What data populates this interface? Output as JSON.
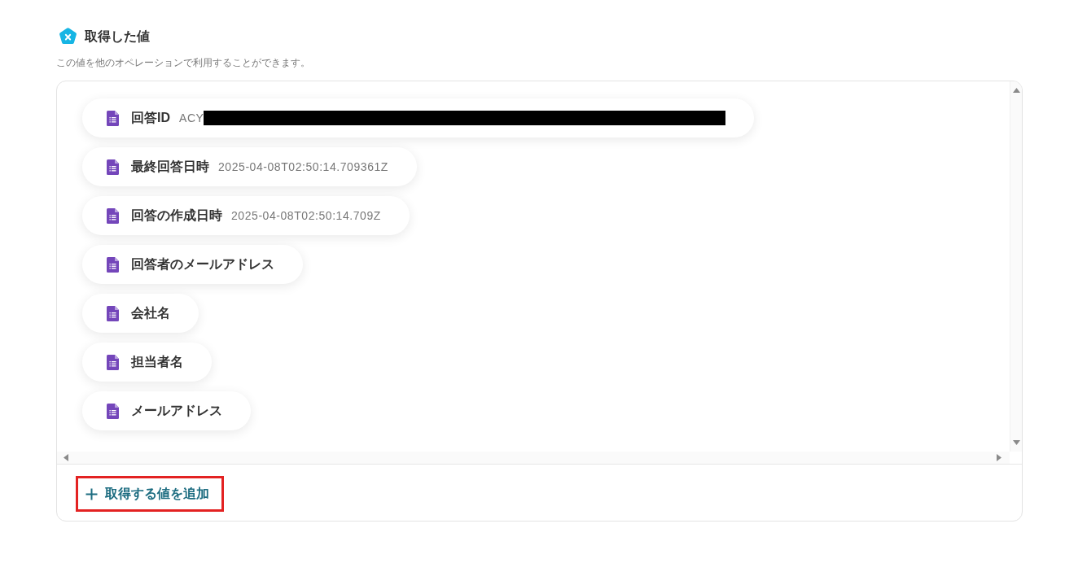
{
  "section": {
    "title": "取得した値",
    "description": "この値を他のオペレーションで利用することができます。"
  },
  "values": [
    {
      "label": "回答ID",
      "value": "ACY",
      "redacted": true
    },
    {
      "label": "最終回答日時",
      "value": "2025-04-08T02:50:14.709361Z",
      "redacted": false
    },
    {
      "label": "回答の作成日時",
      "value": "2025-04-08T02:50:14.709Z",
      "redacted": false
    },
    {
      "label": "回答者のメールアドレス",
      "redacted": false
    },
    {
      "label": "会社名",
      "redacted": false
    },
    {
      "label": "担当者名",
      "redacted": false
    },
    {
      "label": "メールアドレス",
      "redacted": false
    }
  ],
  "add_button": {
    "label": "取得する値を追加",
    "highlighted": true
  }
}
